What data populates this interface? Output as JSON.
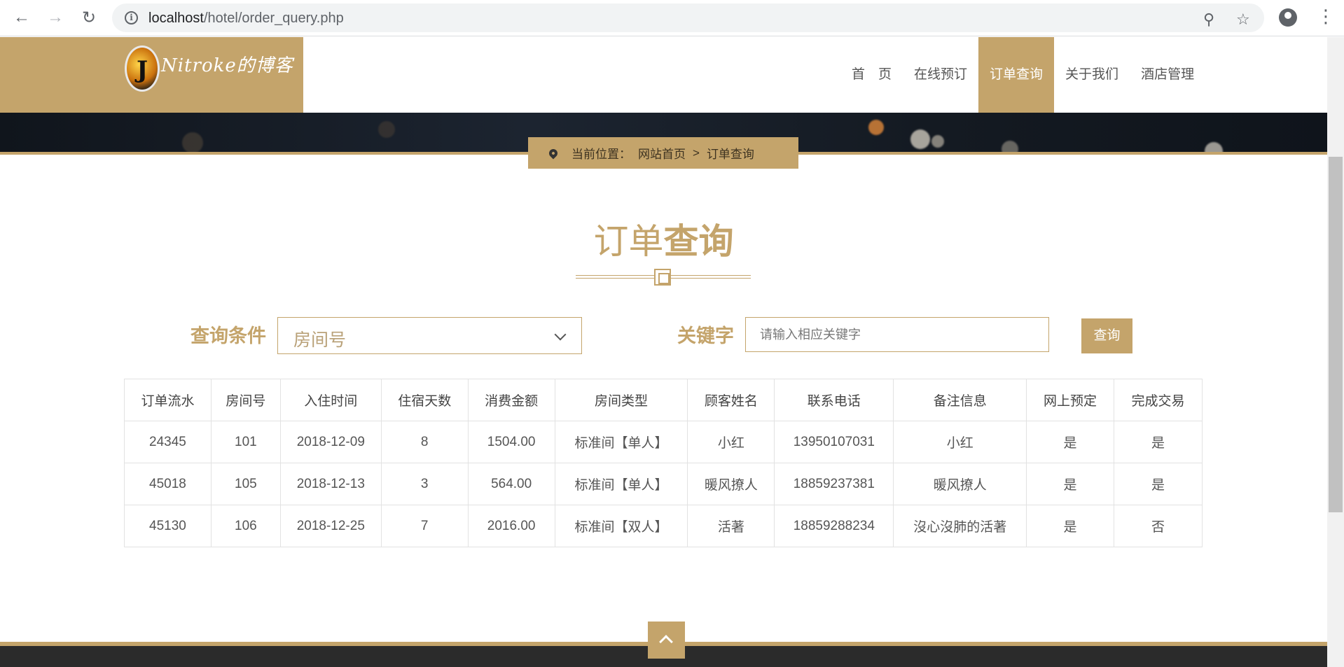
{
  "browser": {
    "back_icon": "arrow-left-icon",
    "forward_icon": "arrow-right-icon",
    "reload_icon": "reload-icon",
    "url_host": "localhost",
    "url_path": "/hotel/order_query.php",
    "zoom_icon": "zoom-icon",
    "bookmark_icon": "star-icon"
  },
  "site": {
    "logo_letter": "J",
    "logo_text": "Nitroke的博客",
    "nav": [
      {
        "label": "首　页"
      },
      {
        "label": "在线预订"
      },
      {
        "label": "订单查询",
        "active": true
      },
      {
        "label": "关于我们"
      },
      {
        "label": "酒店管理"
      }
    ]
  },
  "breadcrumb": {
    "prefix": "当前位置：",
    "home": "网站首页",
    "separator": ">",
    "current": "订单查询"
  },
  "title": {
    "part1": "订单",
    "part2": "查询"
  },
  "query": {
    "condition_label": "查询条件",
    "condition_value": "房间号",
    "keyword_label": "关键字",
    "keyword_placeholder": "请输入相应关键字",
    "submit_label": "查询"
  },
  "table": {
    "headers": [
      "订单流水",
      "房间号",
      "入住时间",
      "住宿天数",
      "消费金额",
      "房间类型",
      "顾客姓名",
      "联系电话",
      "备注信息",
      "网上预定",
      "完成交易"
    ],
    "rows": [
      [
        "24345",
        "101",
        "2018-12-09",
        "8",
        "1504.00",
        "标准间【单人】",
        "小红",
        "13950107031",
        "小红",
        "是",
        "是"
      ],
      [
        "45018",
        "105",
        "2018-12-13",
        "3",
        "564.00",
        "标准间【单人】",
        "暖风撩人",
        "18859237381",
        "暖风撩人",
        "是",
        "是"
      ],
      [
        "45130",
        "106",
        "2018-12-25",
        "7",
        "2016.00",
        "标准间【双人】",
        "活著",
        "18859288234",
        "沒心沒肺的活著",
        "是",
        "否"
      ]
    ]
  },
  "colors": {
    "accent": "#c4a46b",
    "footer": "#2b2b2b"
  }
}
